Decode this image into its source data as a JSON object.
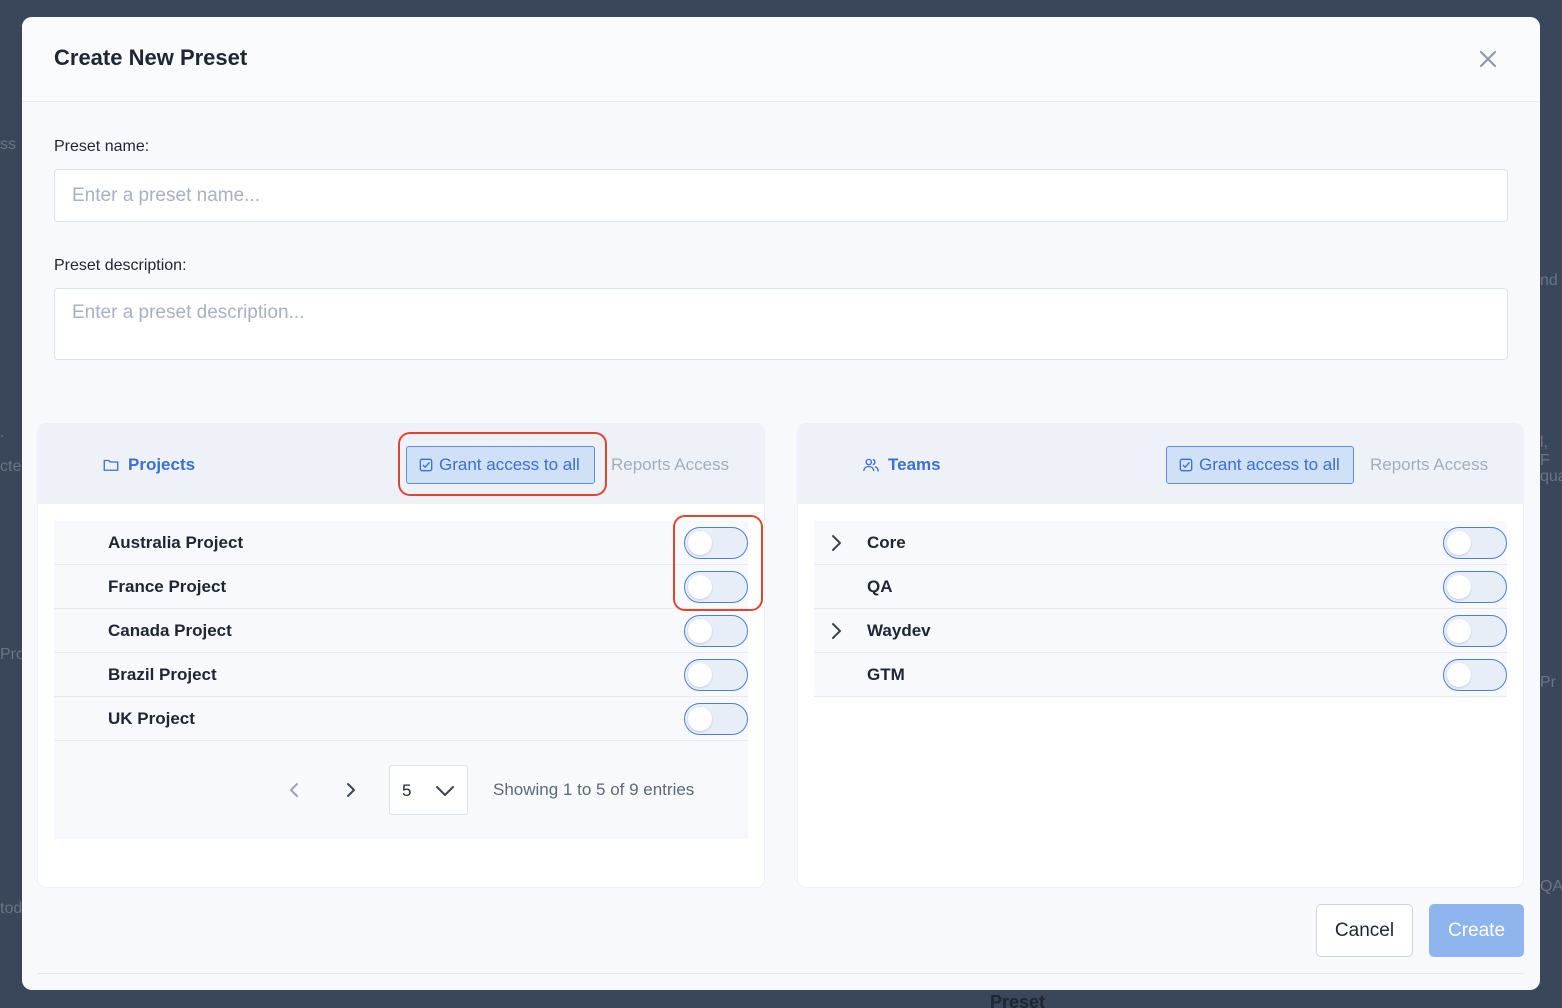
{
  "modal": {
    "title": "Create New Preset",
    "close_icon": "close-icon"
  },
  "form": {
    "name_label": "Preset name:",
    "name_placeholder": "Enter a preset name...",
    "description_label": "Preset description:",
    "description_placeholder": "Enter a preset description..."
  },
  "projects_panel": {
    "title": "Projects",
    "icon": "folder-icon",
    "grant_label": "Grant access to all",
    "reports_label": "Reports Access",
    "rows": [
      {
        "label": "Australia Project",
        "enabled": false
      },
      {
        "label": "France Project",
        "enabled": false
      },
      {
        "label": "Canada Project",
        "enabled": false
      },
      {
        "label": "Brazil Project",
        "enabled": false
      },
      {
        "label": "UK Project",
        "enabled": false
      }
    ],
    "pagination": {
      "page_size": "5",
      "info": "Showing 1 to 5 of 9 entries"
    }
  },
  "teams_panel": {
    "title": "Teams",
    "icon": "users-icon",
    "grant_label": "Grant access to all",
    "reports_label": "Reports Access",
    "rows": [
      {
        "label": "Core",
        "expandable": true,
        "enabled": false
      },
      {
        "label": "QA",
        "expandable": false,
        "enabled": false
      },
      {
        "label": "Waydev",
        "expandable": true,
        "enabled": false
      },
      {
        "label": "GTM",
        "expandable": false,
        "enabled": false
      }
    ]
  },
  "footer": {
    "cancel_label": "Cancel",
    "create_label": "Create"
  },
  "colors": {
    "accent": "#3b6fd0",
    "highlight": "#e2452e",
    "create_disabled": "#8fb5ef"
  }
}
